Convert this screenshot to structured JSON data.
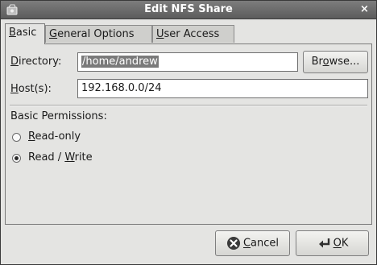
{
  "window": {
    "title": "Edit NFS Share",
    "close_glyph": "×"
  },
  "tabs": [
    {
      "label": "Basic",
      "mnemonic": "B",
      "rest": "asic",
      "active": true
    },
    {
      "label": "General Options",
      "mnemonic": "G",
      "rest": "eneral Options",
      "active": false
    },
    {
      "label": "User Access",
      "mnemonic": "U",
      "rest": "ser Access",
      "active": false
    }
  ],
  "basic": {
    "directory": {
      "label_mnemonic": "D",
      "label_rest": "irectory:",
      "value": "/home/andrew",
      "selected": true
    },
    "browse_button": {
      "pre": "Br",
      "mnemonic": "o",
      "post": "wse..."
    },
    "hosts": {
      "label_mnemonic": "H",
      "label_rest": "ost(s):",
      "value": "192.168.0.0/24"
    },
    "permissions": {
      "heading": "Basic Permissions:",
      "options": [
        {
          "mnemonic": "R",
          "pre": "",
          "post": "ead-only",
          "checked": false
        },
        {
          "mnemonic": "W",
          "pre": "Read / ",
          "post": "rite",
          "checked": true
        }
      ]
    }
  },
  "buttons": {
    "cancel": {
      "mnemonic": "C",
      "rest": "ancel",
      "icon": "cancel-icon"
    },
    "ok": {
      "mnemonic": "O",
      "rest": "K",
      "icon": "ok-enter-icon"
    }
  },
  "icons": {
    "window": "nfs-share-icon"
  },
  "colors": {
    "titlebar": "#6b6b6b",
    "window_bg": "#e4e4e2",
    "selection": "#7a7a7a"
  }
}
